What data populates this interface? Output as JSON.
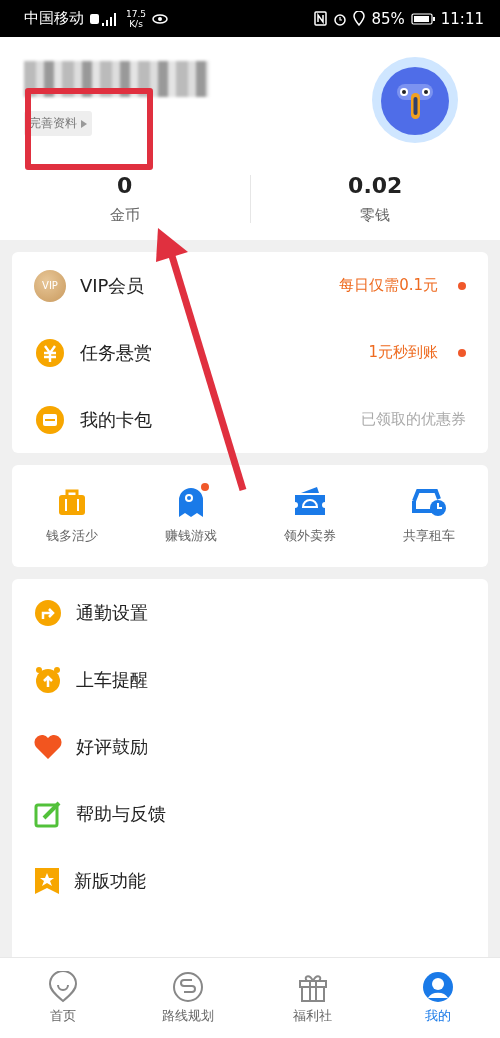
{
  "status_bar": {
    "carrier": "中国移动",
    "speed": "17.5",
    "speed_unit": "K/s",
    "battery": "85%",
    "time": "11:11"
  },
  "profile": {
    "edit_link": "完善资料",
    "stats": [
      {
        "value": "0",
        "label": "金币"
      },
      {
        "value": "0.02",
        "label": "零钱"
      }
    ]
  },
  "benefits": [
    {
      "kind": "vip",
      "badge": "VIP",
      "label": "VIP会员",
      "note": "每日仅需0.1元",
      "highlight": true,
      "dot": true
    },
    {
      "kind": "yuan",
      "label": "任务悬赏",
      "note": "1元秒到账",
      "highlight": true,
      "dot": true
    },
    {
      "kind": "card",
      "label": "我的卡包",
      "note": "已领取的优惠券",
      "highlight": false,
      "dot": false
    }
  ],
  "shortcuts": [
    {
      "kind": "briefcase",
      "label": "钱多活少",
      "dot": false
    },
    {
      "kind": "ghost",
      "label": "赚钱游戏",
      "dot": true
    },
    {
      "kind": "ticket",
      "label": "领外卖券",
      "dot": false
    },
    {
      "kind": "car",
      "label": "共享租车",
      "dot": false
    }
  ],
  "menu": [
    {
      "kind": "commute",
      "label": "通勤设置"
    },
    {
      "kind": "alarm",
      "label": "上车提醒"
    },
    {
      "kind": "heart",
      "label": "好评鼓励"
    },
    {
      "kind": "feedback",
      "label": "帮助与反馈"
    },
    {
      "kind": "star",
      "label": "新版功能"
    }
  ],
  "tabs": [
    {
      "kind": "home",
      "label": "首页",
      "selected": false
    },
    {
      "kind": "route",
      "label": "路线规划",
      "selected": false
    },
    {
      "kind": "gift",
      "label": "福利社",
      "selected": false
    },
    {
      "kind": "me",
      "label": "我的",
      "selected": true
    }
  ],
  "annotation": {
    "frame": true,
    "arrow": true
  }
}
